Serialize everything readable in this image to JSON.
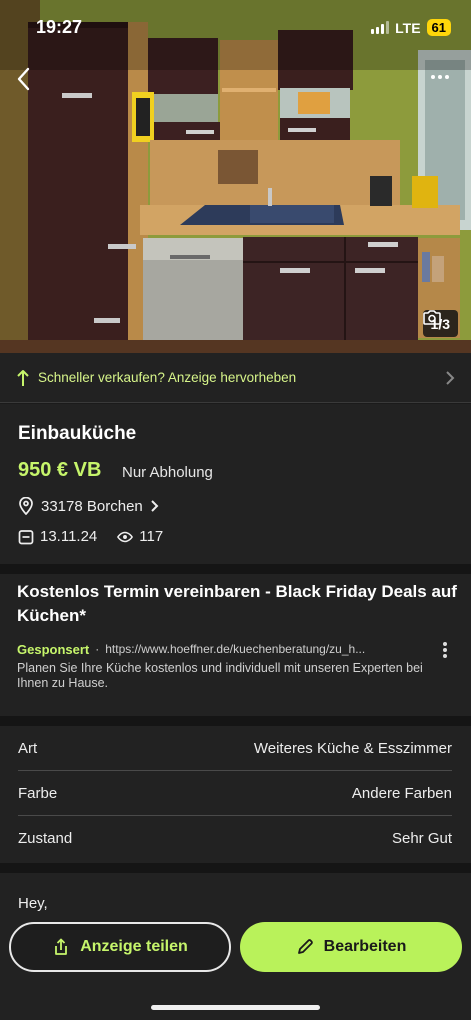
{
  "status_bar": {
    "time": "19:27",
    "network": "LTE",
    "battery": "61"
  },
  "gallery": {
    "counter": "1/3"
  },
  "promote_bar": {
    "label": "Schneller verkaufen? Anzeige hervorheben"
  },
  "listing": {
    "title": "Einbauküche",
    "price": "950 € VB",
    "pickup": "Nur Abholung",
    "location": "33178 Borchen",
    "date": "13.11.24",
    "views": "117"
  },
  "ad": {
    "title": "Kostenlos Termin vereinbaren - Black Friday Deals auf Küchen*",
    "sponsored_label": "Gesponsert",
    "separator": "·",
    "url": "https://www.hoeffner.de/kuechenberatung/zu_h...",
    "description": "Planen Sie Ihre Küche kostenlos und individuell mit unseren Experten bei Ihnen zu Hause."
  },
  "details": [
    {
      "label": "Art",
      "value": "Weiteres Küche & Esszimmer"
    },
    {
      "label": "Farbe",
      "value": "Andere Farben"
    },
    {
      "label": "Zustand",
      "value": "Sehr Gut"
    }
  ],
  "description": {
    "text": "Hey,"
  },
  "actions": {
    "share_label": "Anzeige teilen",
    "edit_label": "Bearbeiten"
  },
  "colors": {
    "accent": "#c6f56b",
    "background": "#222222",
    "button_edit": "#b9f25a"
  },
  "icons": [
    "back-arrow-icon",
    "more-icon",
    "camera-icon",
    "arrow-up-icon",
    "chevron-right-icon",
    "location-pin-icon",
    "calendar-icon",
    "eye-icon",
    "kebab-icon",
    "share-icon",
    "pencil-icon"
  ]
}
